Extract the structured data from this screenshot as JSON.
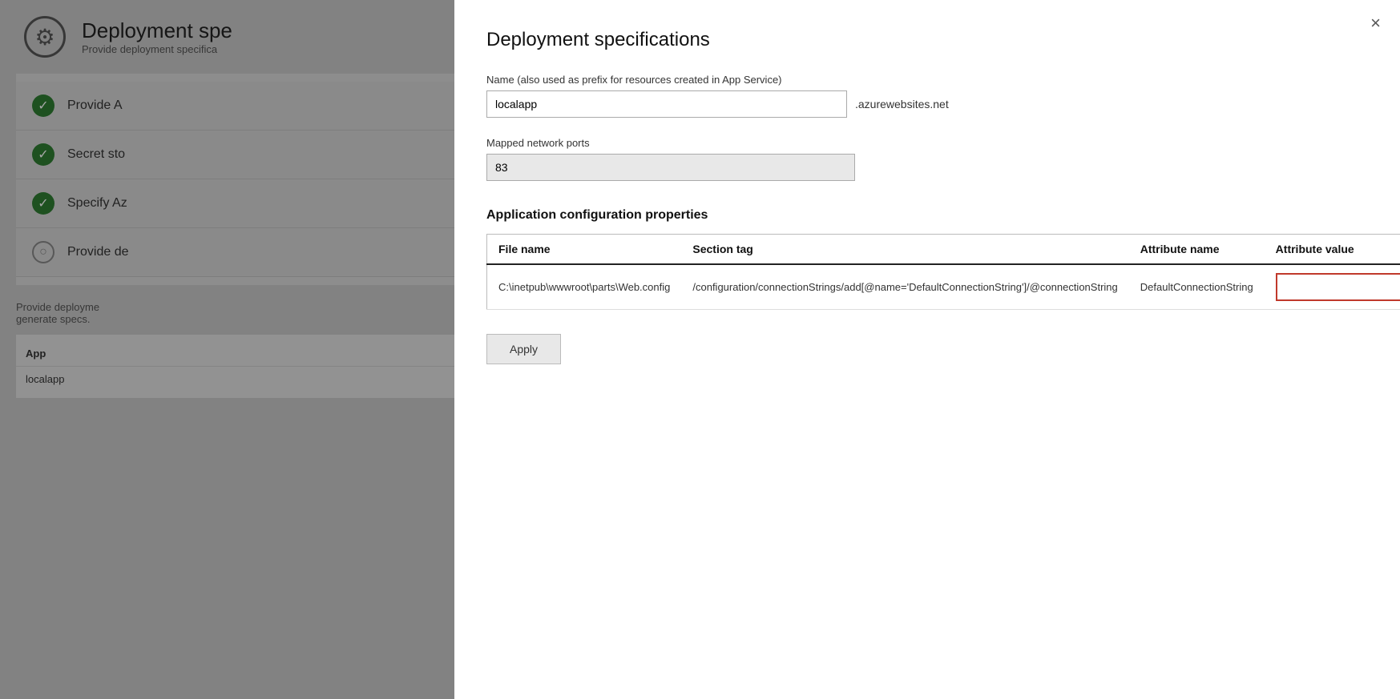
{
  "page": {
    "background_title": "Deployment spe",
    "background_subtitle": "Provide deployment specifica",
    "gear_symbol": "⚙"
  },
  "steps": [
    {
      "id": 1,
      "label": "Provide A",
      "status": "complete",
      "check": "✓"
    },
    {
      "id": 2,
      "label": "Secret sto",
      "status": "complete",
      "check": "✓"
    },
    {
      "id": 3,
      "label": "Specify Az",
      "status": "complete",
      "check": "✓"
    },
    {
      "id": 4,
      "label": "Provide de",
      "status": "partial",
      "check": "○"
    }
  ],
  "bottom_text": "Provide deployme",
  "bottom_text2": "generate specs.",
  "table_header1": "App",
  "table_row1": "localapp",
  "modal": {
    "title": "Deployment specifications",
    "close_label": "×",
    "name_label": "Name (also used as prefix for resources created in App Service)",
    "name_value": "localapp",
    "name_suffix": ".azurewebsites.net",
    "ports_label": "Mapped network ports",
    "ports_value": "83",
    "section_title": "Application configuration properties",
    "table": {
      "col1": "File name",
      "col2": "Section tag",
      "col3": "Attribute name",
      "col4": "Attribute value",
      "rows": [
        {
          "file_name": "C:\\inetpub\\wwwroot\\parts\\Web.config",
          "section_tag": "/configuration/connectionStrings/add[@name='DefaultConnectionString']/@connectionString",
          "attr_name": "DefaultConnectionString",
          "attr_value": ""
        }
      ]
    },
    "apply_label": "Apply"
  }
}
